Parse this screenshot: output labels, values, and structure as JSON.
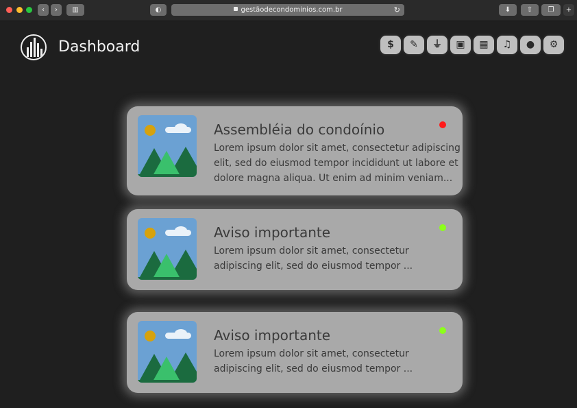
{
  "browser": {
    "url": "gestãodecondominios.com.br",
    "traffic_lights": [
      "#ff5f57",
      "#febc2e",
      "#28c840"
    ]
  },
  "app": {
    "title": "Dashboard"
  },
  "toolbar": [
    {
      "icon": "dollar-icon",
      "glyph": "$"
    },
    {
      "icon": "wrench-icon",
      "glyph": "🔧"
    },
    {
      "icon": "plug-icon",
      "glyph": "⚡"
    },
    {
      "icon": "calculator-icon",
      "glyph": "±"
    },
    {
      "icon": "calendar-icon",
      "glyph": "▦"
    },
    {
      "icon": "bell-icon",
      "glyph": "🔔"
    },
    {
      "icon": "user-icon",
      "glyph": "●"
    },
    {
      "icon": "gear-icon",
      "glyph": "⚙"
    }
  ],
  "cards": [
    {
      "title": "Assembléia do condoínio",
      "body": "Lorem ipsum dolor sit amet, consectetur adipiscing elit, sed do eiusmod tempor incididunt ut labore et dolore magna aliqua. Ut enim ad minim veniam...",
      "status_color": "#ff1a1a"
    },
    {
      "title": "Aviso importante",
      "body": "Lorem ipsum dolor sit amet, consectetur adipiscing elit, sed do eiusmod tempor ...",
      "status_color": "#8cff1a"
    },
    {
      "title": "Aviso importante",
      "body": "Lorem ipsum dolor sit amet, consectetur adipiscing elit, sed do eiusmod tempor ...",
      "status_color": "#8cff1a"
    }
  ]
}
